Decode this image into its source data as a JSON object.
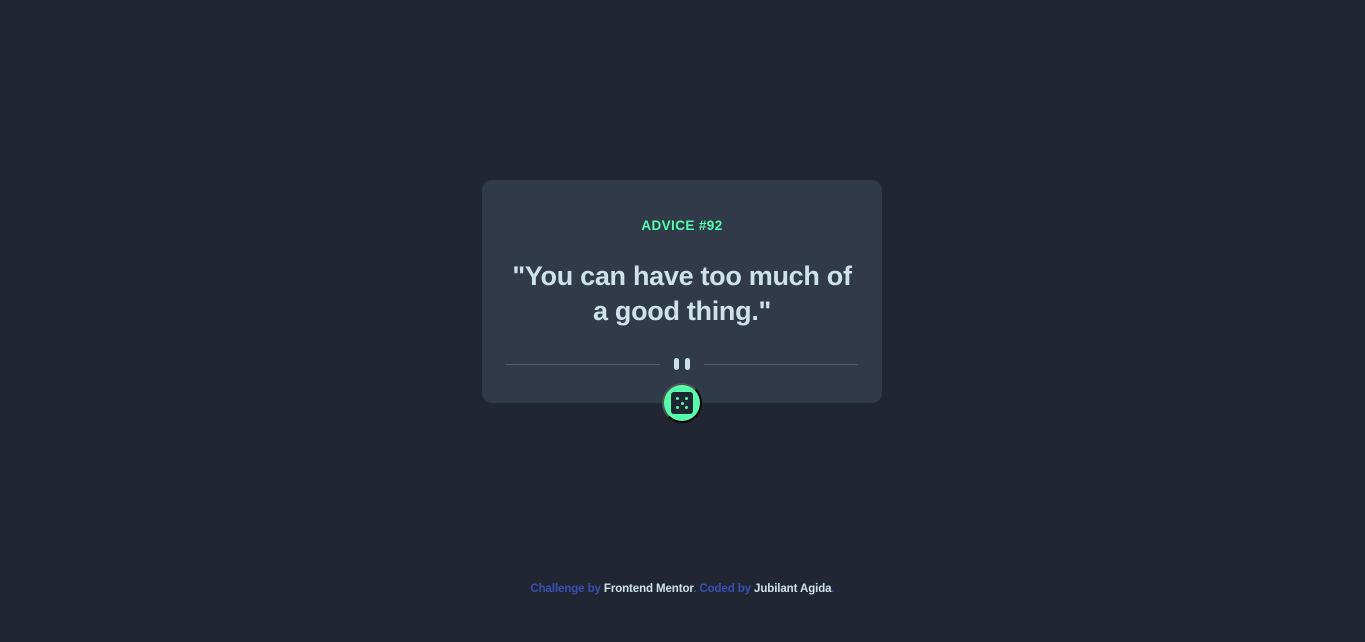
{
  "card": {
    "advice_label": "ADVICE #92",
    "quote": "\"You can have too much of a good thing.\""
  },
  "icons": {
    "divider": "pause-icon",
    "button": "dice-icon"
  },
  "colors": {
    "background": "#202632",
    "card": "#313a48",
    "accent": "#53ffaa",
    "text": "#cee3e9",
    "link": "#3a4fb5"
  },
  "attribution": {
    "challenge_prefix": "Challenge by",
    "challenge_link": "Frontend Mentor",
    "separator": ".",
    "coded_prefix": "Coded by",
    "coded_link": "Jubilant Agida",
    "end": "."
  }
}
